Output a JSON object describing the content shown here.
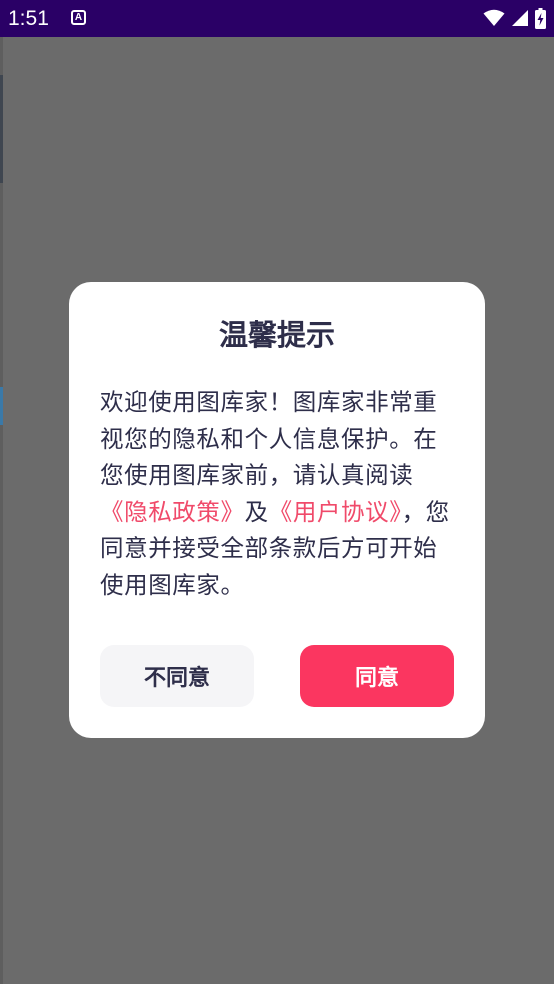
{
  "status_bar": {
    "time": "1:51",
    "notification_icon_glyph": "A",
    "icons": [
      "wifi-icon",
      "signal-icon",
      "battery-charging-icon"
    ]
  },
  "dialog": {
    "title": "温馨提示",
    "body_part1": "欢迎使用图库家！图库家非常重视您的隐私和个人信息保护。在您使用图库家前，请认真阅读",
    "privacy_link": "《隐私政策》",
    "conjunction": "及",
    "agreement_link": "《用户协议》",
    "body_part2": "，您同意并接受全部条款后方可开始使用图库家。",
    "disagree_label": "不同意",
    "agree_label": "同意"
  },
  "colors": {
    "status_bar": "#2a0066",
    "overlay": "#6b6b6b",
    "accent": "#fb3660",
    "link": "#f04a6a",
    "text": "#2e2e4a"
  }
}
